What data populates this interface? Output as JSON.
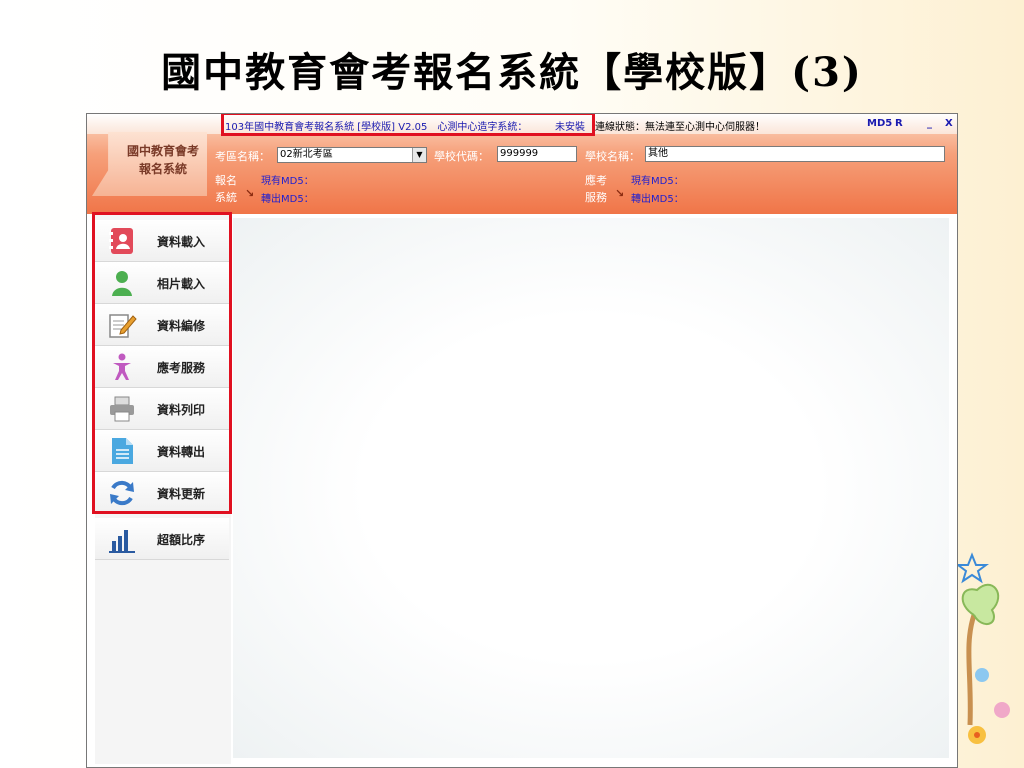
{
  "slide": {
    "title": "國中教育會考報名系統【學校版】(3)"
  },
  "window": {
    "title": "103年國中教育會考報名系統 [學校版] V2.05　心測中心造字系統：",
    "font_status": "未安裝",
    "connection": "連線狀態：無法連至心測中心伺服器！",
    "md5_label": "MD5",
    "r_label": "R",
    "minimize": "_",
    "close": "X"
  },
  "logo": {
    "line1": "國中教育會考",
    "line2": "報名系統"
  },
  "form": {
    "region_label": "考區名稱：",
    "region_value": "02新北考區",
    "school_code_label": "學校代碼：",
    "school_code_value": "999999",
    "school_name_label": "學校名稱：",
    "school_name_value": "其他"
  },
  "register": {
    "line1": "報名",
    "line2": "系統",
    "current_md5": "現有MD5：",
    "export_md5": "轉出MD5："
  },
  "exam_service": {
    "line1": "應考",
    "line2": "服務",
    "current_md5": "現有MD5：",
    "export_md5": "轉出MD5："
  },
  "menu": {
    "items": [
      {
        "label": "資料載入",
        "icon": "contacts-book-icon"
      },
      {
        "label": "相片載入",
        "icon": "person-icon"
      },
      {
        "label": "資料編修",
        "icon": "edit-document-icon"
      },
      {
        "label": "應考服務",
        "icon": "person-standing-icon"
      },
      {
        "label": "資料列印",
        "icon": "printer-icon"
      },
      {
        "label": "資料轉出",
        "icon": "document-icon"
      },
      {
        "label": "資料更新",
        "icon": "refresh-icon"
      },
      {
        "label": "超額比序",
        "icon": "bar-chart-icon"
      }
    ]
  },
  "colors": {
    "highlight": "#e01020",
    "header_accent": "#f07548",
    "link_blue": "#2020d0"
  }
}
